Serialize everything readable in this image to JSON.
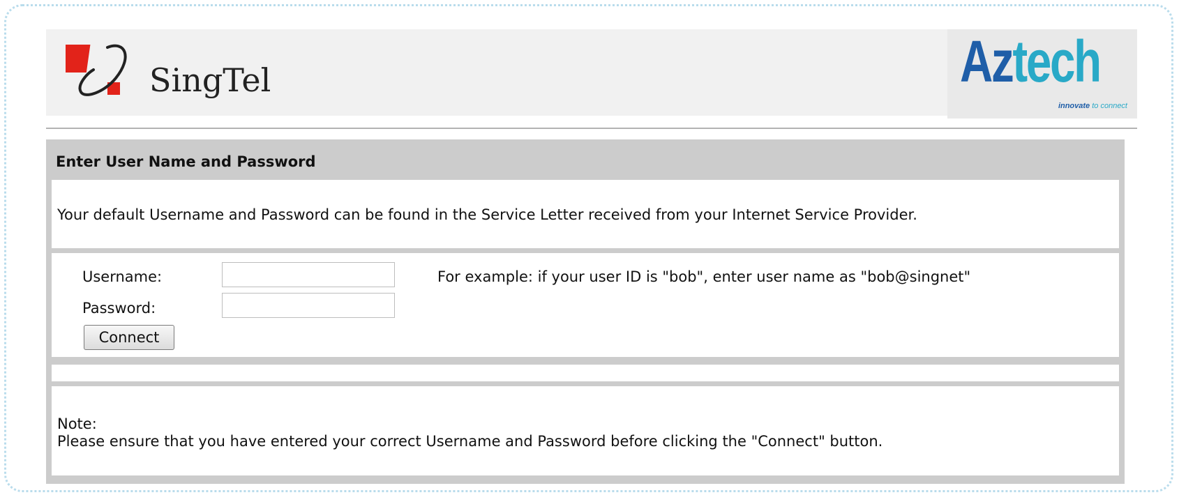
{
  "brand": {
    "isp_name": "SingTel",
    "vendor_name_part1": "Az",
    "vendor_name_part2": "tech",
    "vendor_tagline_part1": "innovate ",
    "vendor_tagline_part2": "to connect",
    "colors": {
      "singtel_red": "#e2231a",
      "aztech_blue": "#1f5ea8",
      "aztech_cyan": "#29a9c7"
    }
  },
  "panel": {
    "title": "Enter User Name and Password",
    "intro": "Your default Username and Password can be found in the Service Letter received from your Internet Service Provider."
  },
  "form": {
    "username_label": "Username:",
    "username_value": "",
    "password_label": "Password:",
    "password_value": "",
    "username_hint": "For example: if your user ID is \"bob\", enter user name as \"bob@singnet\"",
    "connect_label": "Connect"
  },
  "note": {
    "label": "Note:",
    "text": "Please ensure that you have entered your correct Username and Password before clicking the \"Connect\" button."
  }
}
